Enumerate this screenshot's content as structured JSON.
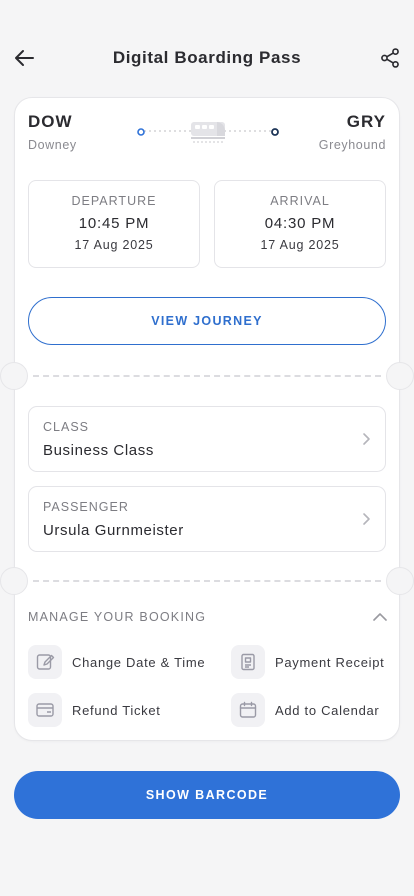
{
  "header": {
    "title": "Digital Boarding Pass"
  },
  "trip": {
    "origin": {
      "code": "DOW",
      "city": "Downey"
    },
    "destination": {
      "code": "GRY",
      "city": "Greyhound"
    },
    "departure": {
      "label": "DEPARTURE",
      "time": "10:45 PM",
      "date": "17 Aug 2025"
    },
    "arrival": {
      "label": "ARRIVAL",
      "time": "04:30 PM",
      "date": "17 Aug 2025"
    }
  },
  "view_journey_label": "VIEW JOURNEY",
  "class_card": {
    "label": "CLASS",
    "value": "Business Class"
  },
  "passenger_card": {
    "label": "PASSENGER",
    "value": "Ursula Gurnmeister"
  },
  "manage": {
    "title": "MANAGE YOUR BOOKING",
    "actions": [
      {
        "label": "Change Date & Time",
        "icon": "edit-icon"
      },
      {
        "label": "Payment Receipt",
        "icon": "receipt-icon"
      },
      {
        "label": "Refund Ticket",
        "icon": "refund-card-icon"
      },
      {
        "label": "Add to Calendar",
        "icon": "calendar-icon"
      }
    ]
  },
  "barcode_label": "SHOW BARCODE",
  "colors": {
    "accent": "#2f72d8",
    "route_dot_end": "#1d3557"
  }
}
